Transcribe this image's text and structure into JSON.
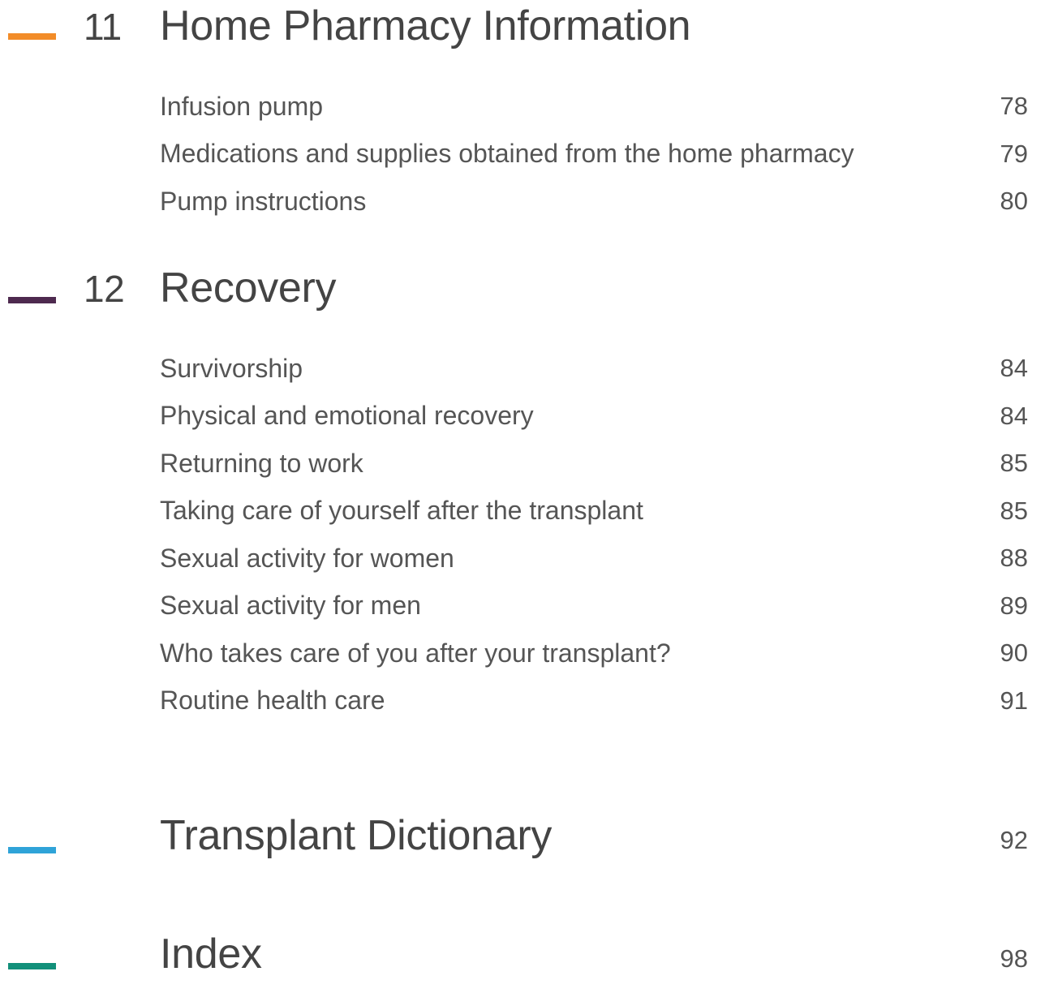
{
  "colors": {
    "orange": "#F28C28",
    "purple": "#4E2A4F",
    "blue": "#2FA3D8",
    "green": "#12907A"
  },
  "sections": [
    {
      "number": "11",
      "title": "Home Pharmacy Information",
      "entries": [
        {
          "label": "Infusion pump",
          "page": "78"
        },
        {
          "label": "Medications and supplies obtained from the home pharmacy",
          "page": "79"
        },
        {
          "label": "Pump instructions",
          "page": "80"
        }
      ]
    },
    {
      "number": "12",
      "title": "Recovery",
      "entries": [
        {
          "label": "Survivorship",
          "page": "84"
        },
        {
          "label": "Physical and emotional recovery",
          "page": "84"
        },
        {
          "label": "Returning to work",
          "page": "85"
        },
        {
          "label": "Taking care of yourself after the transplant",
          "page": "85"
        },
        {
          "label": "Sexual activity for women",
          "page": "88"
        },
        {
          "label": "Sexual activity for men",
          "page": "89"
        },
        {
          "label": "Who takes care of you after your transplant?",
          "page": "90"
        },
        {
          "label": "Routine health care",
          "page": "91"
        }
      ]
    },
    {
      "title": "Transplant Dictionary",
      "page": "92"
    },
    {
      "title": "Index",
      "page": "98"
    }
  ]
}
